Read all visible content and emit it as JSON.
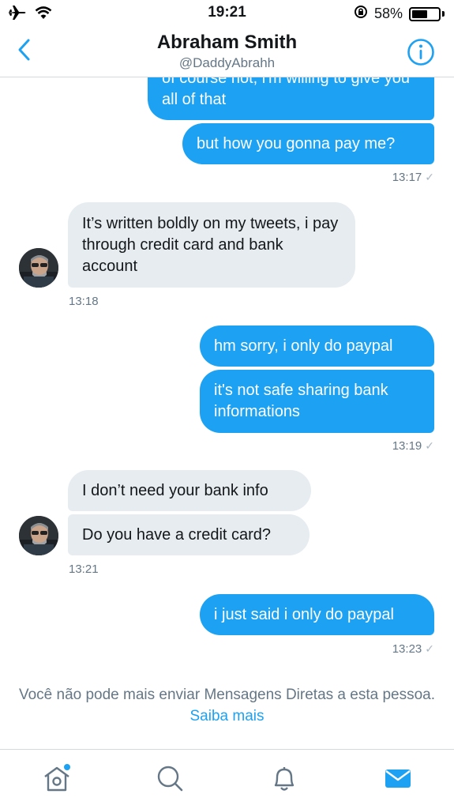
{
  "status_bar": {
    "time": "19:21",
    "battery_text": "58%",
    "battery_level": 0.58,
    "icons": [
      "airplane-icon",
      "wifi-icon",
      "rotation-lock-icon",
      "battery-icon"
    ]
  },
  "header": {
    "name": "Abraham Smith",
    "handle": "@DaddyAbrahh",
    "back_icon": "chevron-left-icon",
    "info_icon": "info-icon"
  },
  "conversation": {
    "messages": [
      {
        "direction": "out",
        "text": "of course not, i'm willing to give you all of that"
      },
      {
        "direction": "out",
        "text": "but how you gonna pay me?"
      },
      {
        "timestamp": "13:17"
      },
      {
        "direction": "in",
        "text": "It’s written boldly on my tweets, i pay through credit card and bank account"
      },
      {
        "timestamp": "13:18"
      },
      {
        "direction": "out",
        "text": "hm sorry, i only do paypal"
      },
      {
        "direction": "out",
        "text": "it's not safe sharing bank informations"
      },
      {
        "timestamp": "13:19"
      },
      {
        "direction": "in",
        "text": "I don’t need your bank info"
      },
      {
        "direction": "in",
        "text": "Do you have a credit card?"
      },
      {
        "timestamp": "13:21"
      },
      {
        "direction": "out",
        "text": "i just said i only do paypal"
      },
      {
        "timestamp": "13:23"
      }
    ]
  },
  "notice": {
    "text": "Você não pode mais enviar Mensagens Diretas a esta pessoa.",
    "link": "Saiba mais"
  },
  "tabbar": {
    "tabs": [
      "home-icon",
      "search-icon",
      "notifications-icon",
      "messages-icon"
    ],
    "active": "messages-icon",
    "accent_color": "#1da1f2"
  },
  "colors": {
    "outgoing_bubble": "#1da1f2",
    "incoming_bubble": "#e6ecf0",
    "secondary_text": "#657786"
  }
}
